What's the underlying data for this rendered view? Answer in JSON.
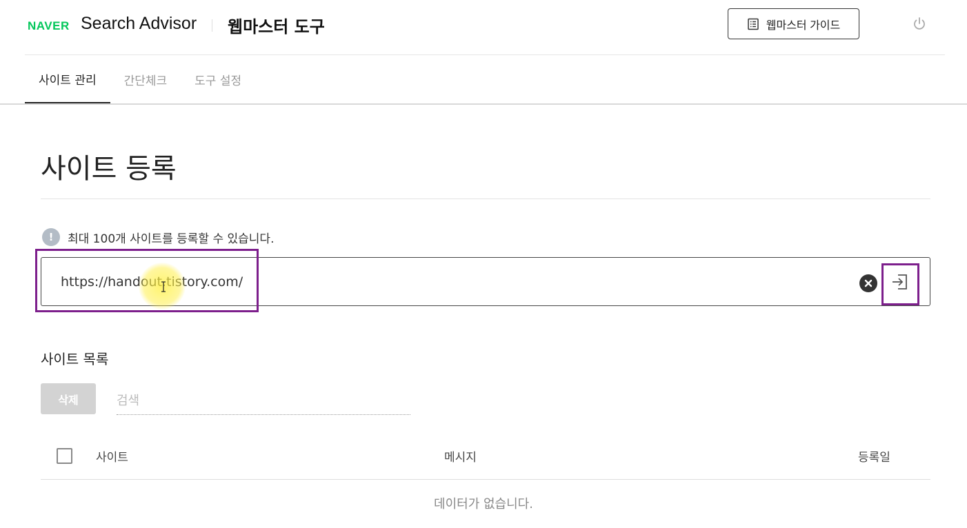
{
  "header": {
    "brand": "NAVER",
    "product": "Search Advisor",
    "tool": "웹마스터 도구",
    "guide_button": "웹마스터 가이드",
    "icons": {
      "guide": "list-doc-icon",
      "logout": "power-icon"
    },
    "brand_color": "#03c75a"
  },
  "tabs": [
    {
      "label": "사이트 관리",
      "active": true
    },
    {
      "label": "간단체크",
      "active": false
    },
    {
      "label": "도구 설정",
      "active": false
    }
  ],
  "main": {
    "title": "사이트 등록",
    "notice": "최대 100개 사이트를 등록할 수 있습니다.",
    "url_input": {
      "value": "https://handout.tistory.com/"
    },
    "icons": {
      "notice": "info-icon",
      "clear": "clear-icon",
      "submit": "enter-icon"
    }
  },
  "site_list": {
    "title": "사이트 목록",
    "delete_button": "삭제",
    "search_placeholder": "검색",
    "columns": {
      "site": "사이트",
      "message": "메시지",
      "date": "등록일"
    },
    "empty_message": "데이터가 없습니다.",
    "rows": []
  },
  "annotation_color": "#7d1f8c"
}
